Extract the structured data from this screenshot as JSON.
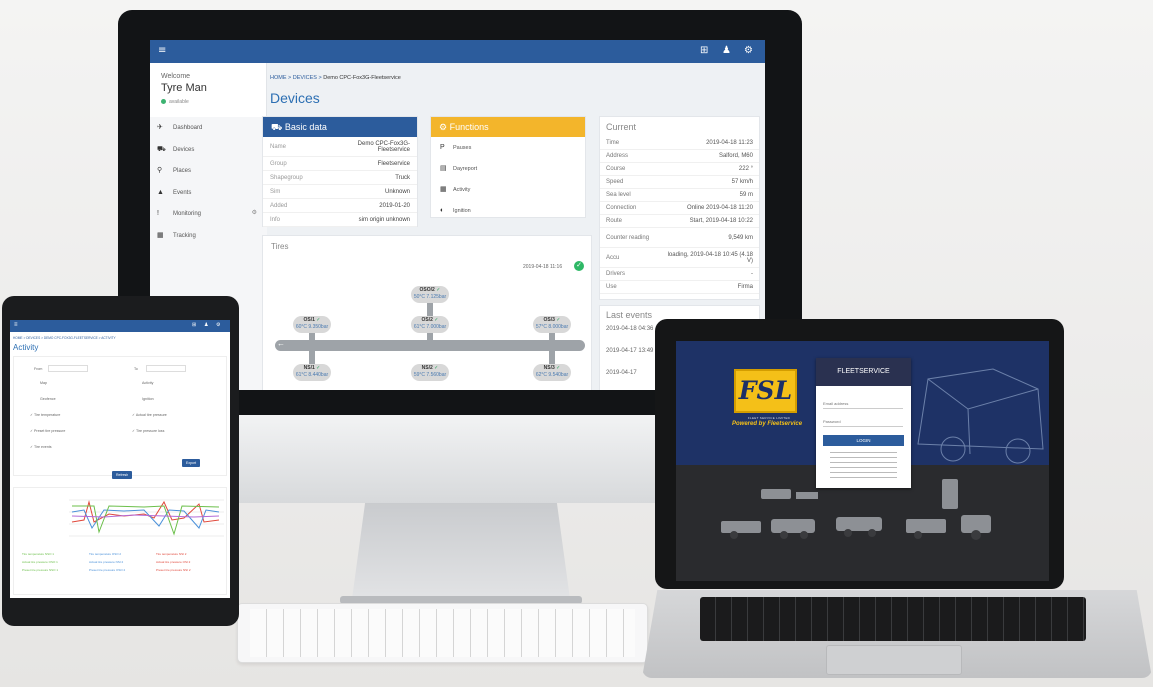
{
  "imac": {
    "topbar": {
      "menu_icon": "≡",
      "icons": [
        "⊞",
        "♟",
        "⚙"
      ]
    },
    "sidebar": {
      "welcome": "Welcome",
      "user": "Tyre Man",
      "status": "available",
      "items": [
        {
          "icon": "dashboard-icon",
          "glyph": "✈",
          "label": "Dashboard"
        },
        {
          "icon": "car-icon",
          "glyph": "⛟",
          "label": "Devices"
        },
        {
          "icon": "map-marker-icon",
          "glyph": "⚲",
          "label": "Places"
        },
        {
          "icon": "warning-icon",
          "glyph": "▲",
          "label": "Events"
        },
        {
          "icon": "exclamation-icon",
          "glyph": "!",
          "label": "Monitoring"
        },
        {
          "icon": "map-icon",
          "glyph": "▦",
          "label": "Tracking"
        }
      ]
    },
    "breadcrumb": {
      "home": "HOME",
      "sep": ">",
      "devices": "DEVICES",
      "current": "Demo CPC-Fox3G-Fleetservice"
    },
    "page_title": "Devices",
    "basic_data": {
      "title": "Basic data",
      "rows": [
        {
          "k": "Name",
          "v": "Demo CPC-Fox3G-Fleetservice"
        },
        {
          "k": "Group",
          "v": "Fleetservice"
        },
        {
          "k": "Shapegroup",
          "v": "Truck"
        },
        {
          "k": "Sim",
          "v": "Unknown"
        },
        {
          "k": "Added",
          "v": "2019-01-20"
        },
        {
          "k": "Info",
          "v": "sim origin unknown"
        }
      ]
    },
    "functions": {
      "title": "Functions",
      "items": [
        {
          "glyph": "P",
          "label": "Pauses"
        },
        {
          "glyph": "▤",
          "label": "Dayreport"
        },
        {
          "glyph": "▦",
          "label": "Activity"
        },
        {
          "glyph": "◐",
          "label": "Ignition"
        }
      ]
    },
    "current": {
      "title": "Current",
      "rows": [
        {
          "k": "Time",
          "v": "2019-04-18 11:23"
        },
        {
          "k": "Address",
          "v": "Salford, M60"
        },
        {
          "k": "Course",
          "v": "222 °"
        },
        {
          "k": "Speed",
          "v": "57 km/h"
        },
        {
          "k": "Sea level",
          "v": "59 m"
        },
        {
          "k": "Connection",
          "v": "Online 2019-04-18 11:20"
        },
        {
          "k": "Route",
          "v": "Start, 2019-04-18 10:22"
        },
        {
          "k": "Counter reading",
          "v": "9,549 km"
        },
        {
          "k": "Accu",
          "v": "loading, 2019-04-18 10:45 (4.18 V)"
        },
        {
          "k": "Drivers",
          "v": "-"
        },
        {
          "k": "Use",
          "v": "Firma"
        }
      ]
    },
    "tires": {
      "title": "Tires",
      "timestamp": "2019-04-18 11:16",
      "items": [
        {
          "id": "OSO/2",
          "ok": "✓",
          "val": "50°C 7.125bar"
        },
        {
          "id": "OS/1",
          "ok": "✓",
          "val": "60°C 9.350bar"
        },
        {
          "id": "OS/2",
          "ok": "✓",
          "val": "61°C 7.000bar"
        },
        {
          "id": "OS/3",
          "ok": "✓",
          "val": "57°C 8.000bar"
        },
        {
          "id": "NS/1",
          "ok": "✓",
          "val": "61°C 8.440bar"
        },
        {
          "id": "NS/2",
          "ok": "✓",
          "val": "59°C 7.560bar"
        },
        {
          "id": "NS/3",
          "ok": "✓",
          "val": "62°C 9.540bar"
        }
      ]
    },
    "last_events": {
      "title": "Last events",
      "items": [
        "2019-04-18 04:36",
        "2019-04-17 13:49",
        "2019-04-17"
      ]
    }
  },
  "tablet": {
    "breadcrumb": "HOME > DEVICES > DEMO CPC-FOX3G-FLEETSERVICE > ACTIVITY",
    "title": "Activity",
    "from_label": "From",
    "to_label": "To",
    "rows": [
      {
        "l": "Map",
        "r": "Activity"
      },
      {
        "l": "Geofence",
        "r": "Ignition"
      },
      {
        "l": "Tire temperature",
        "r": "Actual tire pressure"
      },
      {
        "l": "Preset tire pressure",
        "r": "Tire pressure loss"
      },
      {
        "l": "Tire events",
        "r": ""
      }
    ],
    "export_label": "Export",
    "refresh_label": "Refresh",
    "legend": [
      "Tire temperature NSO 1",
      "Tire temperature OSO 2",
      "Tire temperature NSI 2",
      "Actual tire pressure OSO 1",
      "Actual tire pressure NSI 2",
      "Actual tire pressure OSI 2",
      "Preset tire pressure NSO 1",
      "Preset tire pressure OSO 2",
      "Preset tire pressure NSI 2"
    ]
  },
  "laptop": {
    "logo": "FSL",
    "logo_sub": "FLEET SERVICE LIMITED",
    "tagline": "Powered by Fleetservice",
    "login_title": "FLEETSERVICE",
    "username_placeholder": "Email address",
    "password_placeholder": "Password",
    "login_button": "LOGIN"
  }
}
